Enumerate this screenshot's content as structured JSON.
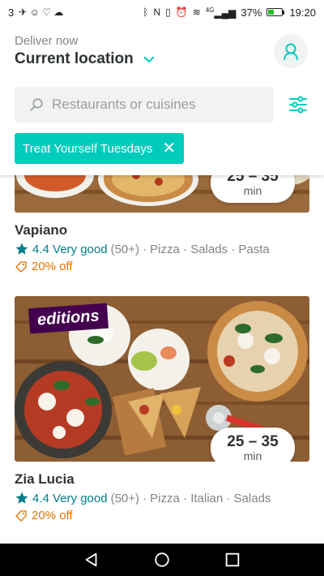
{
  "status_bar": {
    "carrier": "3",
    "battery_percent": "37%",
    "time": "19:20",
    "signal_label": "4G",
    "battery_level": 0.37
  },
  "header": {
    "deliver_label": "Deliver now",
    "location_title": "Current location",
    "icons": {
      "chevron": "chevron-down-icon",
      "account": "account-icon",
      "filter": "filter-icon",
      "search": "search-icon"
    }
  },
  "search": {
    "placeholder": "Restaurants or cuisines"
  },
  "chip": {
    "label": "Treat Yourself Tuesdays"
  },
  "restaurants": [
    {
      "name": "Vapiano",
      "eta_time": "25 – 35",
      "eta_unit": "min",
      "rating": "4.4 Very good",
      "rating_count": "(50+)",
      "tags": "· Pizza · Salads · Pasta",
      "offer": "20% off"
    },
    {
      "name": "Zia Lucia",
      "badge": "editions",
      "eta_time": "25 – 35",
      "eta_unit": "min",
      "rating": "4.4 Very good",
      "rating_count": "(50+)",
      "tags": "· Pizza · Italian · Salads",
      "offer": "20% off"
    }
  ],
  "colors": {
    "accent": "#00ccbc",
    "rating": "#007e8a",
    "offer": "#e37400",
    "editions": "#44004e"
  }
}
